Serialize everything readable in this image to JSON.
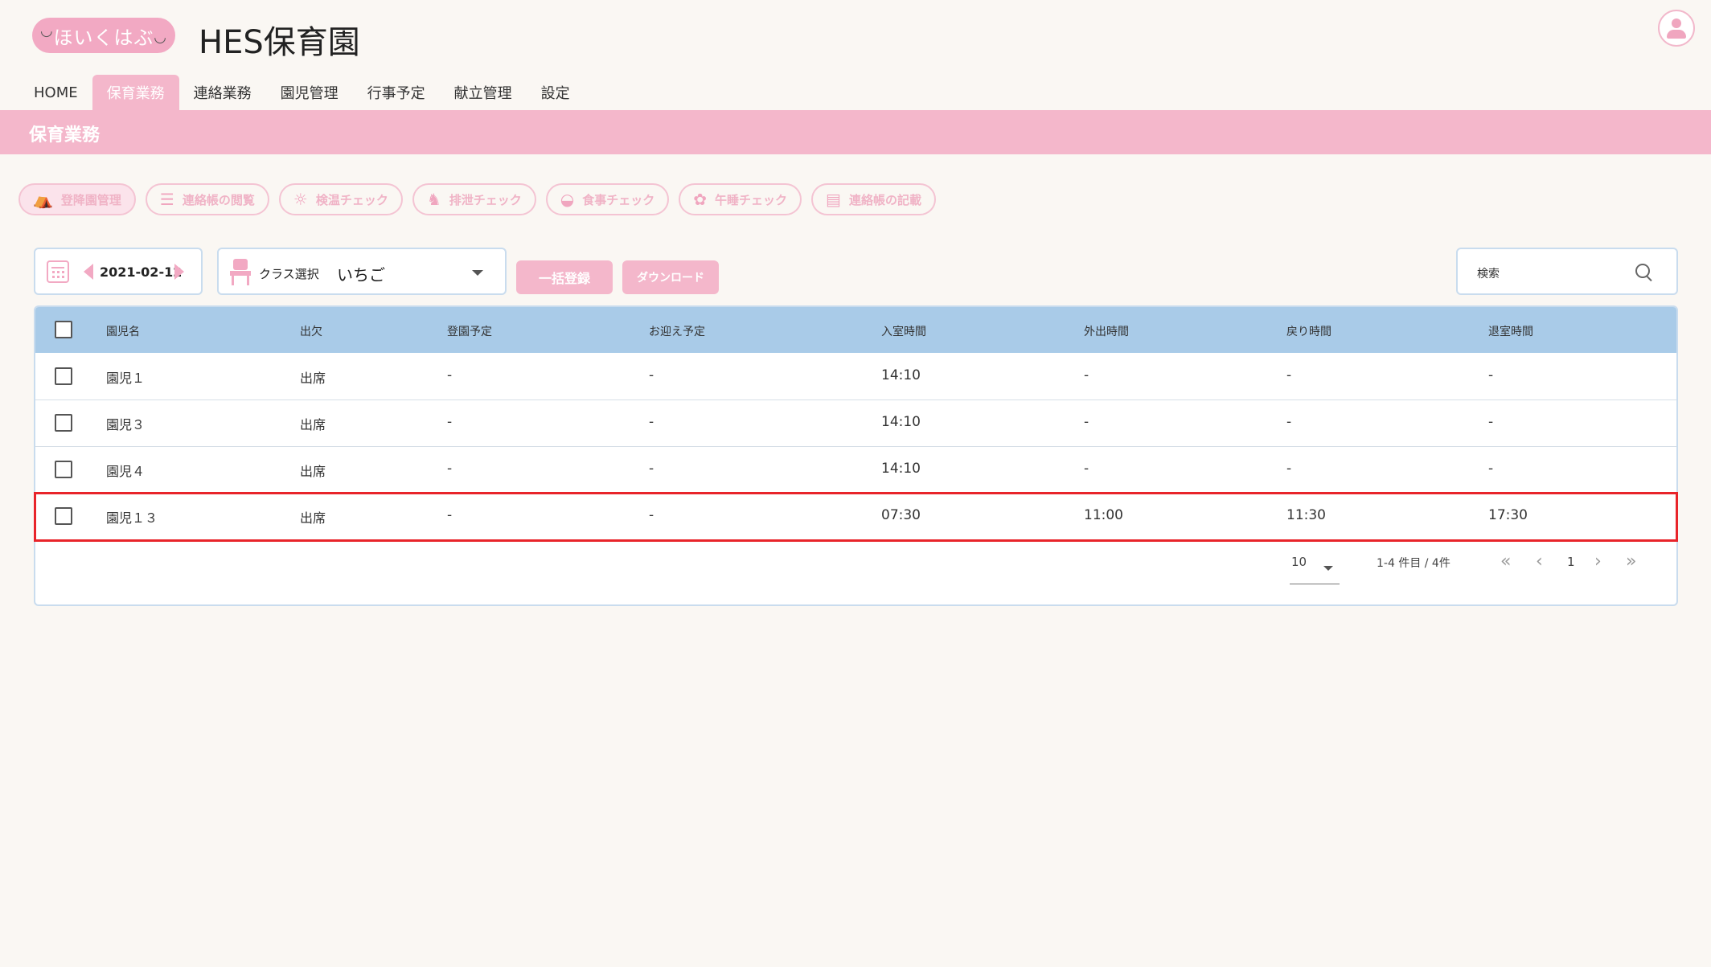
{
  "header": {
    "logo_text": "ほいくはぶ",
    "title": "HES保育園"
  },
  "nav": {
    "tabs": [
      {
        "label": "HOME"
      },
      {
        "label": "保育業務"
      },
      {
        "label": "連絡業務"
      },
      {
        "label": "園児管理"
      },
      {
        "label": "行事予定"
      },
      {
        "label": "献立管理"
      },
      {
        "label": "設定"
      }
    ],
    "active_index": 1
  },
  "banner": {
    "title": "保育業務"
  },
  "functions": [
    {
      "label": "登降園管理",
      "icon": "attendance-icon"
    },
    {
      "label": "連絡帳の閲覧",
      "icon": "list-icon"
    },
    {
      "label": "検温チェック",
      "icon": "thermometer-icon"
    },
    {
      "label": "排泄チェック",
      "icon": "duck-icon"
    },
    {
      "label": "食事チェック",
      "icon": "bowl-icon"
    },
    {
      "label": "午睡チェック",
      "icon": "sleep-icon"
    },
    {
      "label": "連絡帳の記載",
      "icon": "notebook-icon"
    }
  ],
  "toolbar": {
    "date": "2021-02-12",
    "class_label": "クラス選択",
    "class_value": "いちご",
    "bulk_label": "一括登録",
    "download_label": "ダウンロード",
    "search_placeholder": "検索"
  },
  "table": {
    "columns": [
      "園児名",
      "出欠",
      "登園予定",
      "お迎え予定",
      "入室時間",
      "外出時間",
      "戻り時間",
      "退室時間"
    ],
    "rows": [
      [
        "園児１",
        "出席",
        "-",
        "-",
        "14:10",
        "-",
        "-",
        "-"
      ],
      [
        "園児３",
        "出席",
        "-",
        "-",
        "14:10",
        "-",
        "-",
        "-"
      ],
      [
        "園児４",
        "出席",
        "-",
        "-",
        "14:10",
        "-",
        "-",
        "-"
      ],
      [
        "園児１３",
        "出席",
        "-",
        "-",
        "07:30",
        "11:00",
        "11:30",
        "17:30"
      ]
    ],
    "highlight_row_index": 3
  },
  "pagination": {
    "per_page": "10",
    "range_text": "1-4 件目 / 4件",
    "current_page": "1"
  },
  "colors": {
    "accent_pink": "#f4b7cb",
    "header_blue": "#a9cbe8",
    "highlight_red": "#e8242a",
    "background": "#faf7f3"
  }
}
